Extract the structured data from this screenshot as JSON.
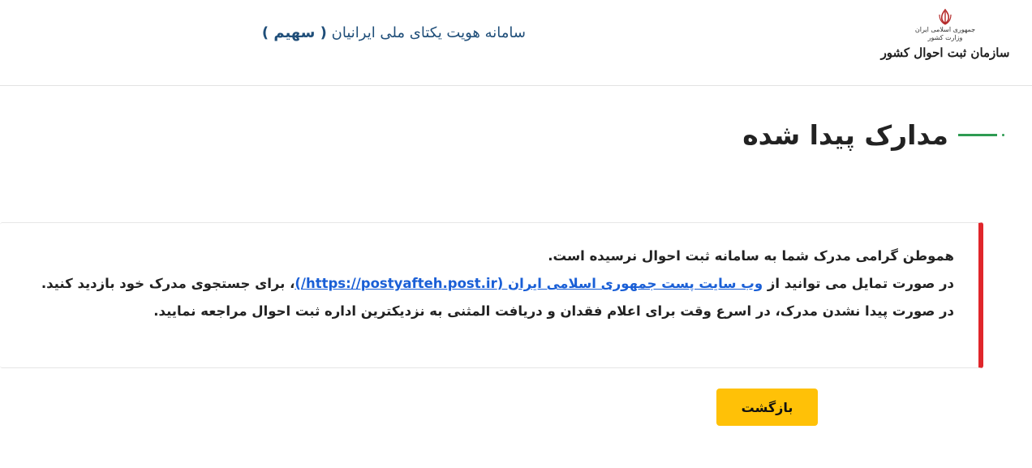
{
  "header": {
    "logo": {
      "emblem_icon": "iran-emblem-icon",
      "sub_line_1": "جمهوری اسلامی ایران",
      "sub_line_2": "وزارت کشور",
      "org_name": "سازمان ثبت احوال کشور"
    },
    "site_title_prefix": "سامانه هویت یکتای ملی ایرانیان",
    "site_title_brand": "( سهیم )"
  },
  "page": {
    "heading": "مدارک پیدا شده"
  },
  "alert": {
    "line1": "هموطن گرامی مدرک شما به سامانه ثبت احوال نرسیده است.",
    "line2_before": "در صورت تمایل می توانید از ",
    "line2_link": "وب سایت پست جمهوری اسلامی ایران (https://postyafteh.post.ir/)",
    "line2_after": "، برای جستجوی مدرک خود بازدید کنید.",
    "line3": "در صورت پیدا نشدن مدرک، در اسرع وقت برای اعلام فقدان و دریافت المثنی به نزدیکترین اداره ثبت احوال مراجعه نمایید."
  },
  "actions": {
    "back_label": "بازگشت"
  },
  "colors": {
    "accent_green": "#2e9b52",
    "alert_red": "#e0262b",
    "button_yellow": "#ffc107",
    "title_blue": "#1f4e79",
    "link_blue": "#1a5fd6"
  }
}
